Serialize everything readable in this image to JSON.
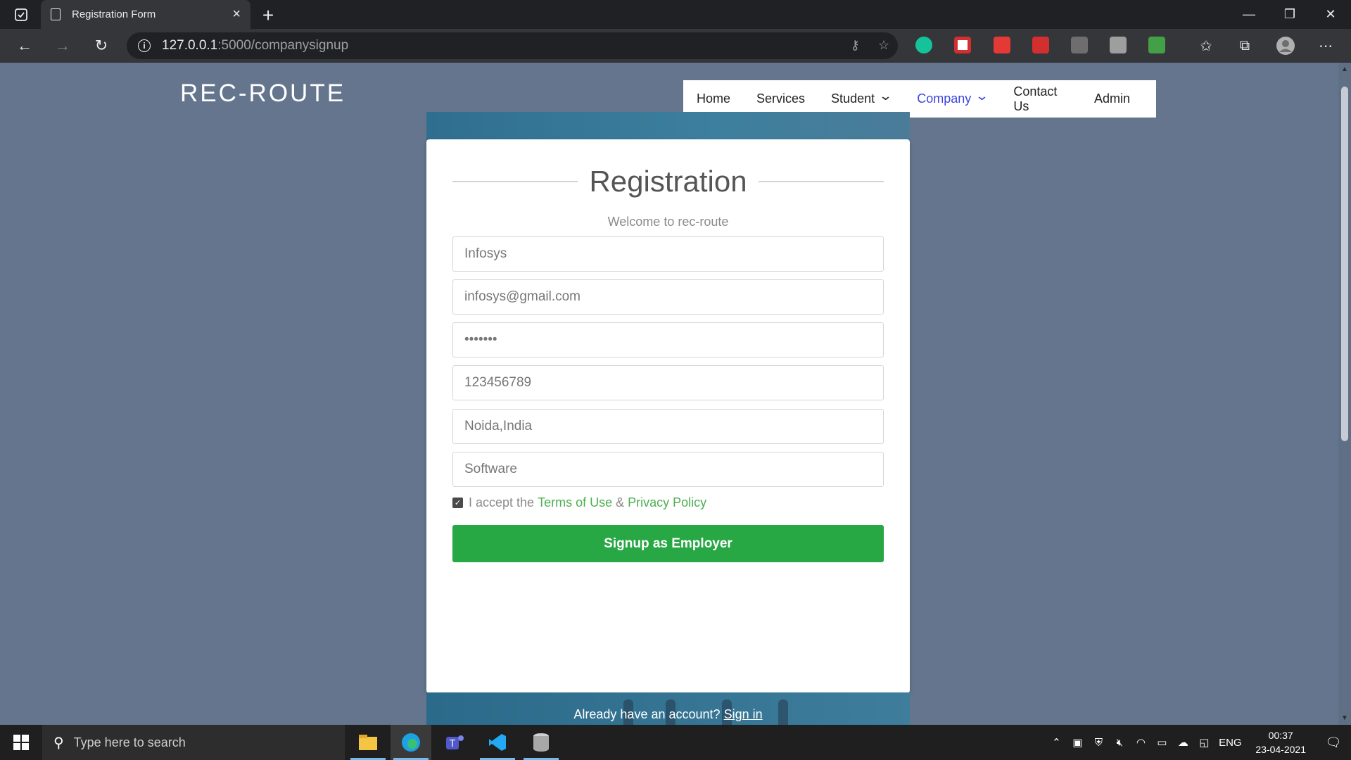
{
  "browser": {
    "tab_title": "Registration Form",
    "url_host": "127.0.0.1",
    "url_rest": ":5000/companysignup"
  },
  "site": {
    "brand": "REC-ROUTE",
    "nav": [
      {
        "label": "Home"
      },
      {
        "label": "Services"
      },
      {
        "label": "Student",
        "dropdown": true
      },
      {
        "label": "Company",
        "dropdown": true,
        "active": true
      },
      {
        "label": "Contact Us"
      },
      {
        "label": "Admin"
      }
    ]
  },
  "form": {
    "title": "Registration",
    "subtitle": "Welcome to rec-route",
    "fields": [
      {
        "name": "company-name-field",
        "value": "Infosys"
      },
      {
        "name": "email-field",
        "value": "infosys@gmail.com"
      },
      {
        "name": "password-field",
        "value": "•••••••"
      },
      {
        "name": "phone-field",
        "value": "123456789"
      },
      {
        "name": "location-field",
        "value": "Noida,India"
      },
      {
        "name": "industry-field",
        "value": "Software"
      }
    ],
    "terms_prefix": "I accept the",
    "terms_link": "Terms of Use",
    "terms_amp": "&",
    "privacy_link": "Privacy Policy",
    "terms_checked": true,
    "submit_label": "Signup as Employer",
    "already_text": "Already have an account?",
    "signin_label": "Sign in"
  },
  "taskbar": {
    "search_placeholder": "Type here to search",
    "language": "ENG",
    "time": "00:37",
    "date": "23-04-2021"
  },
  "colors": {
    "page_bg": "#64758d",
    "accent_green": "#28a745",
    "link_green": "#4caf50",
    "nav_active": "#3b45e0"
  }
}
